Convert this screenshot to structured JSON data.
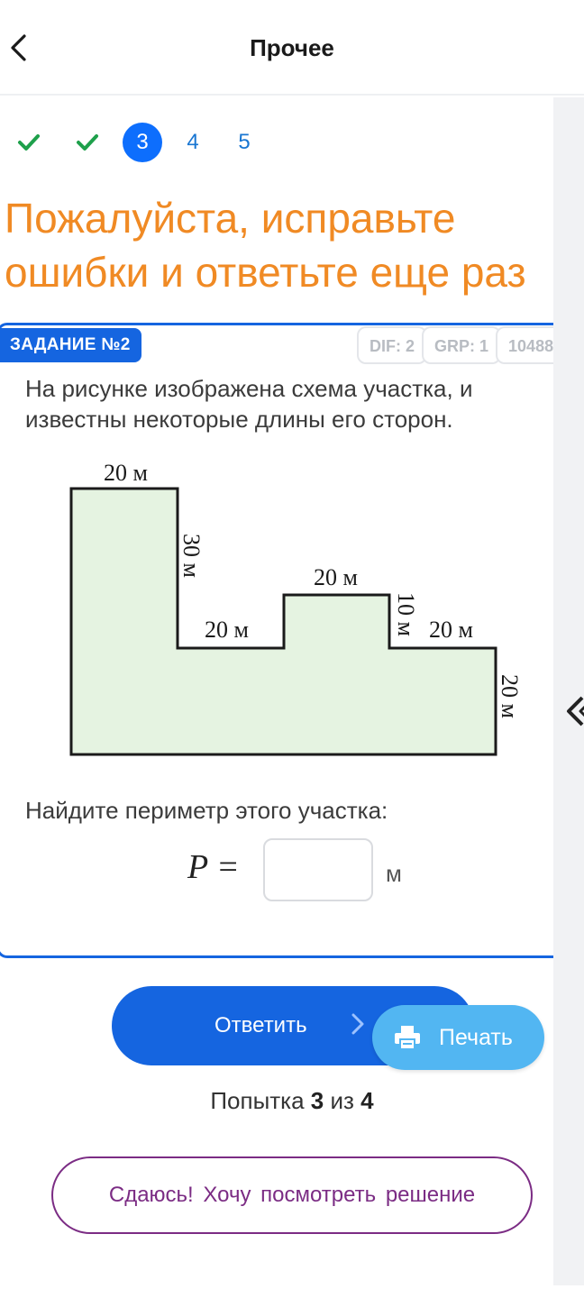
{
  "header": {
    "title": "Прочее"
  },
  "steps": [
    {
      "label": "",
      "state": "done"
    },
    {
      "label": "",
      "state": "done"
    },
    {
      "label": "3",
      "state": "active"
    },
    {
      "label": "4",
      "state": "pending"
    },
    {
      "label": "5",
      "state": "pending"
    }
  ],
  "warning": {
    "line1": "Пожалуйста, исправьте",
    "line2": "ошибки и ответьте еще раз"
  },
  "task": {
    "label": "ЗАДАНИЕ №2",
    "badges": [
      "DIF: 2",
      "GRP: 1",
      "10488"
    ],
    "text": "На рисунке изображена схема участка, и известны некоторые длины его сторон.",
    "figure_labels": {
      "top": "20 м",
      "side1": "30 м",
      "step_low": "20 м",
      "step_top": "20 м",
      "side2": "10 м",
      "step_right": "20 м",
      "side3": "20 м"
    },
    "question": "Найдите периметр этого участка:",
    "formula": "P =",
    "answer": {
      "value": "",
      "placeholder": ""
    },
    "unit": "м"
  },
  "buttons": {
    "answer": "Ответить",
    "answer_arrow": "›",
    "print": "Печать",
    "giveup": "Сдаюсь! Хочу посмотреть решение"
  },
  "attempt": {
    "prefix": "Попытка ",
    "current": "3",
    "middle": " из ",
    "total": "4"
  },
  "colors": {
    "primary": "#1565e0",
    "orange": "#f08a24",
    "print": "#52b6f2",
    "purple": "#7b2c84",
    "check": "#1ea04b",
    "figure_fill": "#e5f3e1"
  }
}
